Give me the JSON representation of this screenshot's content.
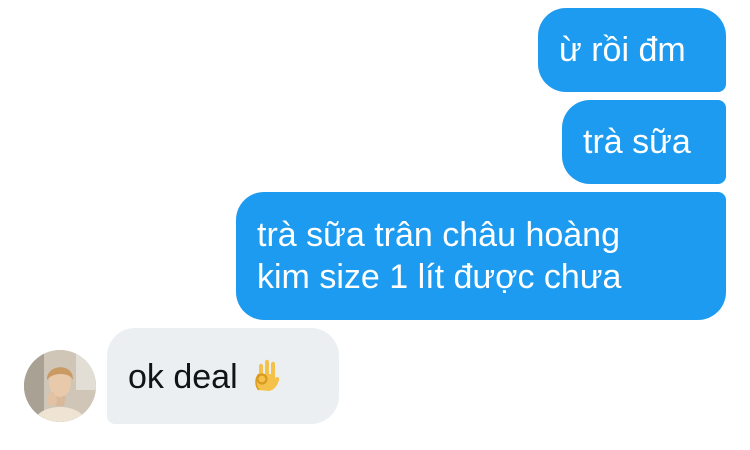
{
  "conversation": {
    "messages": [
      {
        "sender": "me",
        "text": "ừ rồi đm"
      },
      {
        "sender": "me",
        "text": "trà sữa"
      },
      {
        "sender": "me",
        "lines": [
          "trà sữa trân châu hoàng",
          "kim size 1 lít được chưa"
        ]
      },
      {
        "sender": "other",
        "text": "ok deal",
        "emoji": "ok-hand-icon"
      }
    ]
  },
  "colors": {
    "sent_bubble": "#1d9bf0",
    "received_bubble": "#eceff1",
    "received_text": "#0f1419"
  }
}
